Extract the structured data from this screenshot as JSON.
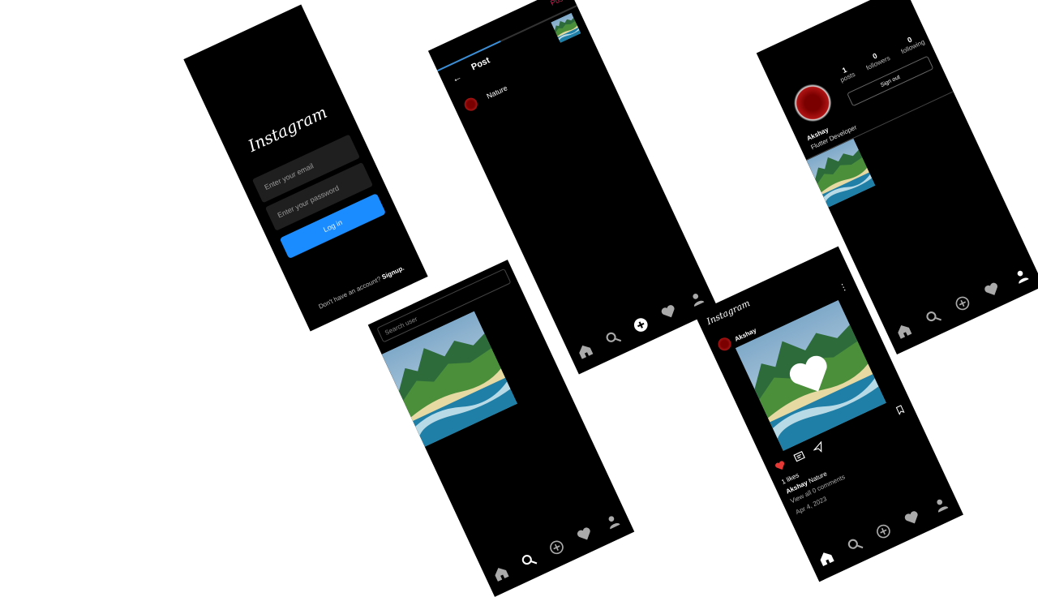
{
  "colors": {
    "accent_blue": "#1a8cff",
    "post_red": "#e0245e",
    "like_red": "#e53935"
  },
  "login": {
    "logo": "Instagram",
    "email_placeholder": "Enter your email",
    "password_placeholder": "Enter your password",
    "login_button": "Log in",
    "signup_prompt": "Don't have an account?",
    "signup_link": "Signup."
  },
  "new_post": {
    "post_action": "Post",
    "title": "Post",
    "caption": "Nature",
    "upload_progress": 0.45
  },
  "profile": {
    "stats": [
      {
        "value": "1",
        "label": "posts"
      },
      {
        "value": "0",
        "label": "followers"
      },
      {
        "value": "0",
        "label": "following"
      }
    ],
    "sign_out": "Sign out",
    "name": "Akshay",
    "bio": "Flutter Developer"
  },
  "search": {
    "placeholder": "Search user"
  },
  "feed": {
    "logo": "Instagram",
    "author": "Akshay",
    "likes": "1 likes",
    "caption_user": "Akshay",
    "caption_text": "Nature",
    "comments": "View all 0 comments",
    "date": "Apr 4, 2023"
  },
  "icons": {
    "nav": [
      "home-icon",
      "search-icon",
      "add-circle-icon",
      "heart-icon",
      "person-icon"
    ]
  }
}
